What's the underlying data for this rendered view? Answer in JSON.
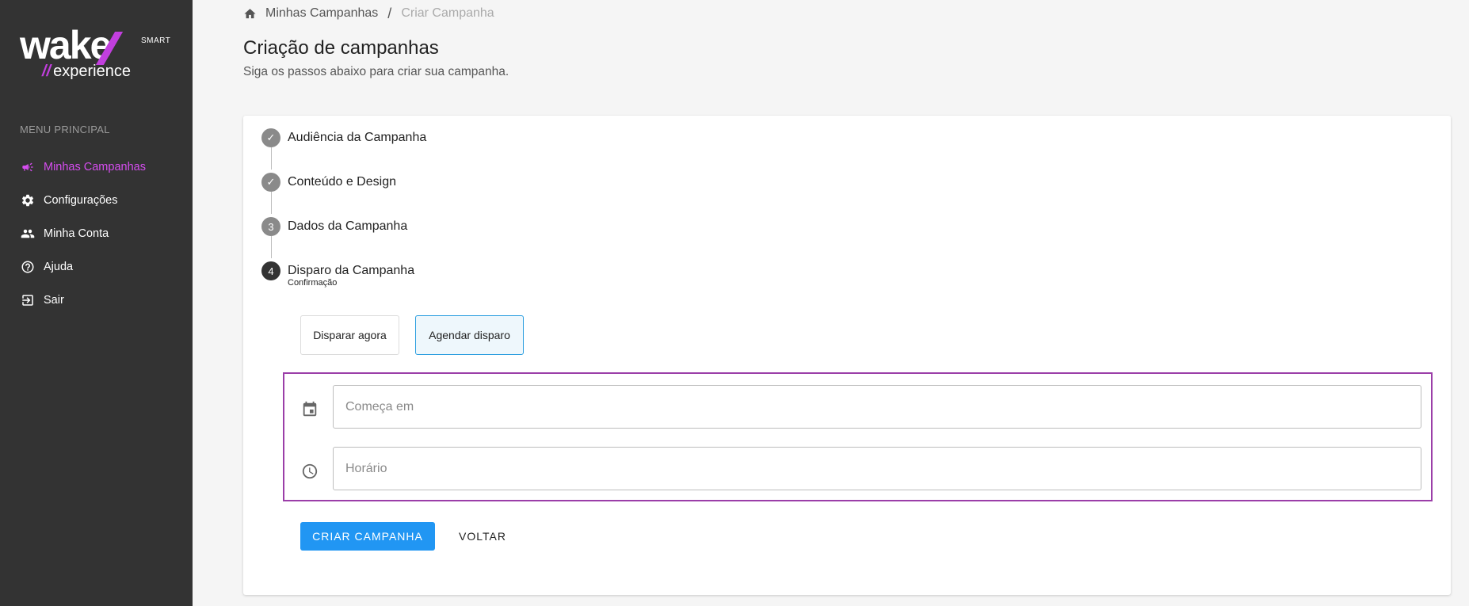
{
  "sidebar": {
    "logo": {
      "wordmark": "wake",
      "badge": "SMART",
      "slashes": "//",
      "tagline": "experience"
    },
    "menu_title": "MENU PRINCIPAL",
    "items": [
      {
        "label": "Minhas Campanhas",
        "icon": "megaphone-icon",
        "active": true
      },
      {
        "label": "Configurações",
        "icon": "gear-icon",
        "active": false
      },
      {
        "label": "Minha Conta",
        "icon": "people-icon",
        "active": false
      },
      {
        "label": "Ajuda",
        "icon": "help-circle-icon",
        "active": false
      },
      {
        "label": "Sair",
        "icon": "logout-icon",
        "active": false
      }
    ],
    "colors": {
      "background": "#333333",
      "accent": "#d64df0"
    }
  },
  "breadcrumb": {
    "home": "Minhas Campanhas",
    "separator": "/",
    "current": "Criar Campanha"
  },
  "header": {
    "title": "Criação de campanhas",
    "subtitle": "Siga os passos abaixo para criar sua campanha."
  },
  "stepper": {
    "steps": [
      {
        "marker": "✓",
        "label": "Audiência da Campanha",
        "sub": "",
        "status": "completed"
      },
      {
        "marker": "✓",
        "label": "Conteúdo e Design",
        "sub": "",
        "status": "completed"
      },
      {
        "marker": "3",
        "label": "Dados da Campanha",
        "sub": "",
        "status": "pending"
      },
      {
        "marker": "4",
        "label": "Disparo da Campanha",
        "sub": "Confirmação",
        "status": "active"
      }
    ]
  },
  "dispatch": {
    "options": [
      {
        "label": "Disparar agora",
        "selected": false
      },
      {
        "label": "Agendar disparo",
        "selected": true
      }
    ],
    "fields": {
      "start": {
        "placeholder": "Começa em",
        "value": "",
        "icon": "calendar-icon"
      },
      "time": {
        "placeholder": "Horário",
        "value": "",
        "icon": "clock-icon"
      }
    },
    "highlight_color": "#9b3ea8"
  },
  "actions": {
    "create": "CRIAR CAMPANHA",
    "back": "VOLTAR",
    "primary_color": "#2196f3"
  }
}
